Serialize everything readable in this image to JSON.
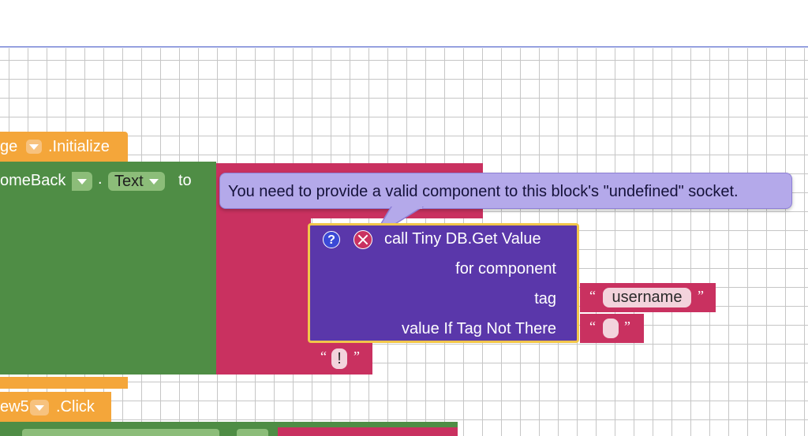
{
  "blocks": {
    "screen_init": {
      "component": "ge",
      "event": ".Initialize"
    },
    "set_text": {
      "component": "omeBack",
      "dot": ".",
      "property": "Text",
      "to_label": "to"
    },
    "tooltip": {
      "message": "You need to provide a valid component to this block's \"undefined\" socket."
    },
    "tinydb_call": {
      "title": "call Tiny DB.Get Value",
      "for_component_label": "for component",
      "tag_label": "tag",
      "value_if_not_there_label": "value If Tag Not There",
      "help_icon_text": "?"
    },
    "tag_string": {
      "open_quote": "“",
      "value": "username",
      "close_quote": "”"
    },
    "empty_string": {
      "open_quote": "“",
      "value": "",
      "close_quote": "”"
    },
    "exclaim_string": {
      "open_quote": "“",
      "value": "!",
      "close_quote": "”"
    },
    "click_event": {
      "component": "ew5",
      "event": ".Click"
    }
  },
  "colors": {
    "event_orange": "#f4a63a",
    "setter_green": "#4f8d45",
    "text_crimson": "#c93160",
    "tinydb_purple": "#5a37aa",
    "tooltip_lavender": "#b4a9ea",
    "selection_yellow": "#f1c64a"
  }
}
